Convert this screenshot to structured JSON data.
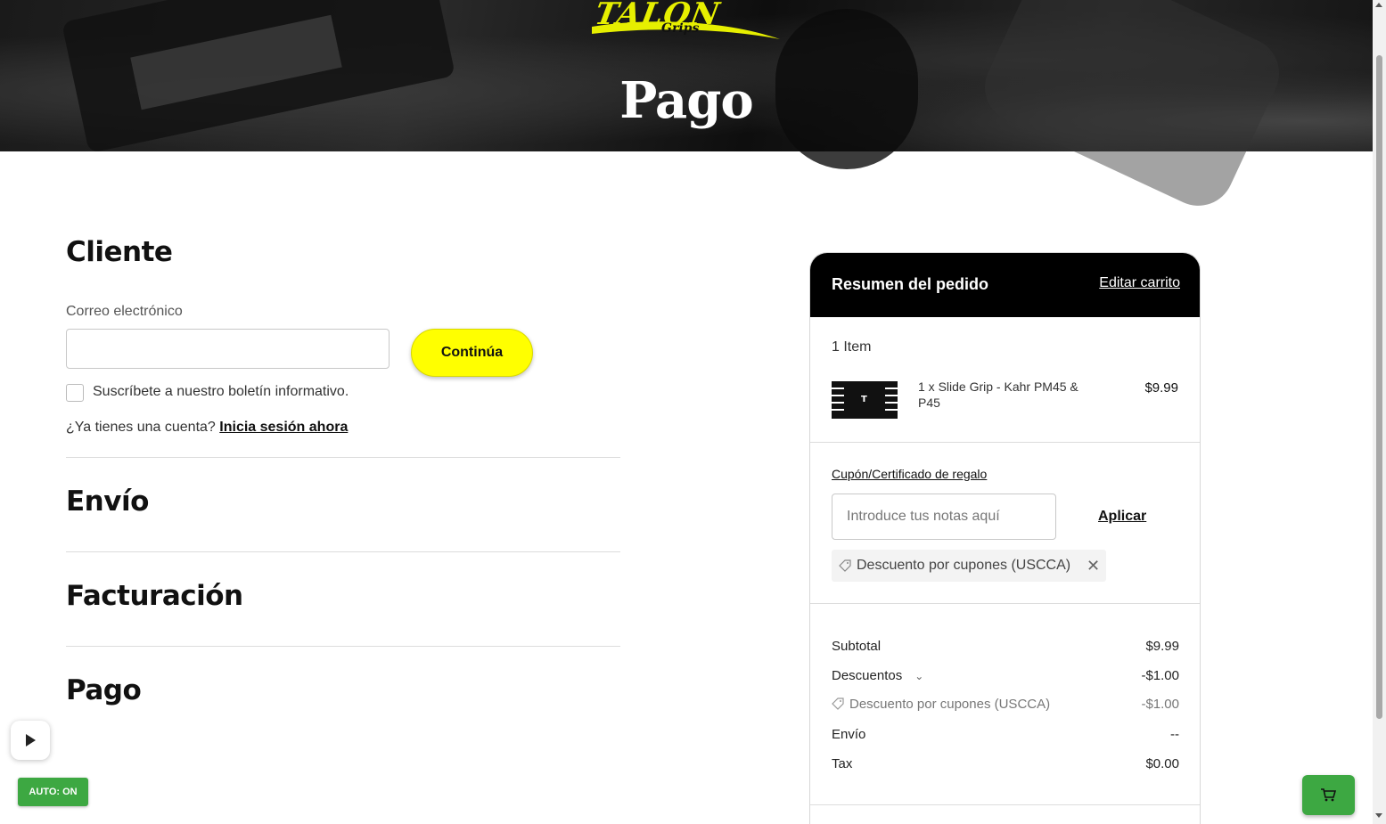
{
  "hero": {
    "brand": "TALON",
    "brand_sub": "Grips",
    "title": "Pago"
  },
  "customer": {
    "title": "Cliente",
    "email_label": "Correo electrónico",
    "email_value": "",
    "continue_label": "Continúa",
    "newsletter_label": "Suscríbete a nuestro boletín informativo.",
    "newsletter_checked": false,
    "login_prompt": "¿Ya tienes una cuenta?",
    "login_link": "Inicia sesión ahora"
  },
  "sections": {
    "shipping": "Envío",
    "billing": "Facturación",
    "payment": "Pago"
  },
  "summary": {
    "title": "Resumen del pedido",
    "edit_cart": "Editar carrito",
    "item_count": "1 Item",
    "item": {
      "name": "1 x Slide Grip - Kahr PM45 & P45",
      "price": "$9.99"
    },
    "coupon_link": "Cupón/Certificado de regalo",
    "coupon_placeholder": "Introduce tus notas aquí",
    "apply_label": "Aplicar",
    "applied_coupon": "Descuento por cupones (USCCA)",
    "rows": {
      "subtotal_label": "Subtotal",
      "subtotal_value": "$9.99",
      "discounts_label": "Descuentos",
      "discounts_value": "-$1.00",
      "coupon_discount_label": "Descuento por cupones (USCCA)",
      "coupon_discount_value": "-$1.00",
      "shipping_label": "Envío",
      "shipping_value": "--",
      "tax_label": "Tax",
      "tax_value": "$0.00"
    }
  },
  "overlays": {
    "auto_badge": "AUTO: ON"
  },
  "colors": {
    "accent_yellow": "#ffff00",
    "header_black": "#000000",
    "green": "#3da842"
  }
}
